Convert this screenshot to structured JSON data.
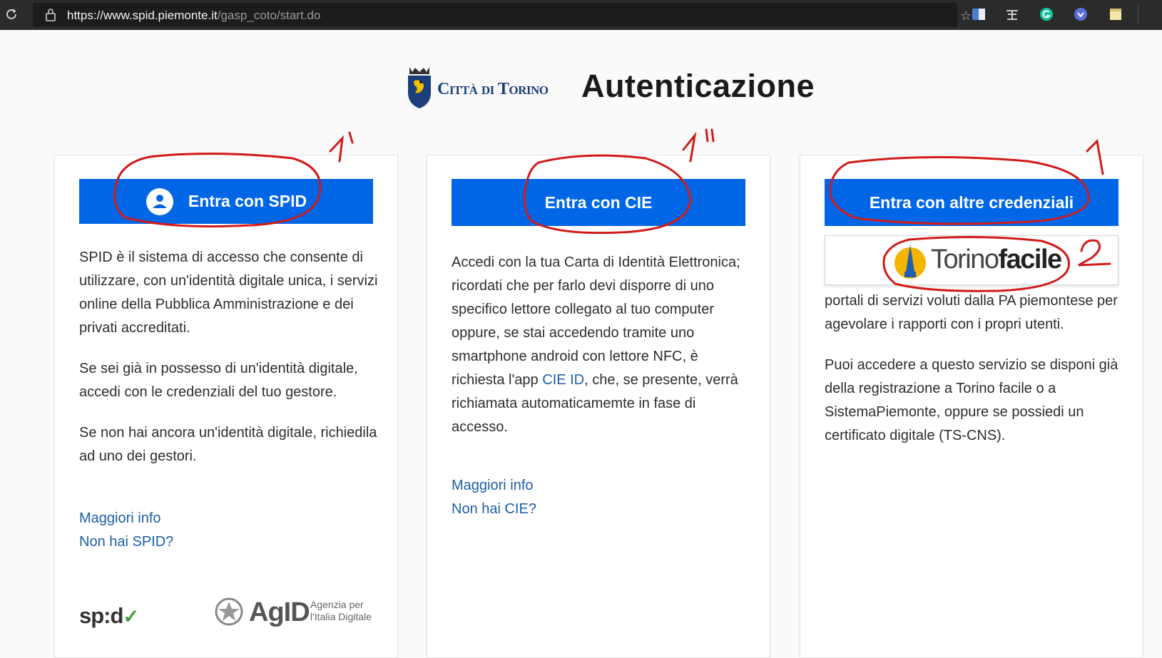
{
  "browser": {
    "url_host": "https://www.spid.piemonte.it",
    "url_path": "/gasp_coto/start.do"
  },
  "header": {
    "city_name": "Città di Torino",
    "title": "Autenticazione"
  },
  "cards": [
    {
      "button_label": "Entra con SPID",
      "paragraphs": [
        "SPID è il sistema di accesso che consente di utilizzare, con un'identità digitale unica, i servizi online della Pubblica Amministrazione e dei privati accreditati.",
        "Se sei già in possesso di un'identità digitale, accedi con le credenziali del tuo gestore.",
        "Se non hai ancora un'identità digitale, richiedila ad uno dei gestori."
      ],
      "link_info": "Maggiori info",
      "link_missing": "Non hai SPID?",
      "logo_spid": "sp:d",
      "logo_agid": "AgID",
      "logo_agid_sub1": "Agenzia per",
      "logo_agid_sub2": "l'Italia Digitale"
    },
    {
      "button_label": "Entra con CIE",
      "text_before_link": "Accedi con la tua Carta di Identità Elettronica; ricordati che per farlo devi disporre di uno specifico lettore collegato al tuo computer oppure, se stai accedendo tramite uno smartphone android con lettore NFC, è richiesta l'app ",
      "inline_link": "CIE ID",
      "text_after_link": ", che, se presente, verrà richiamata automaticamemte in fase di accesso.",
      "link_info": "Maggiori info",
      "link_missing": "Non hai CIE?"
    },
    {
      "button_label": "Entra con altre credenziali",
      "popup_logo_light": "Torino",
      "popup_logo_bold": "facile",
      "paragraphs": [
        "portali di servizi voluti dalla PA piemontese per agevolare i rapporti con i propri utenti.",
        "Puoi accedere a questo servizio se disponi già della registrazione a Torino facile o a SistemaPiemonte, oppure se possiedi un certificato digitale (TS-CNS)."
      ]
    }
  ],
  "annotations": {
    "label_1prime": "1'",
    "label_1double": "1\"",
    "label_1": "1",
    "label_2": "2"
  },
  "colors": {
    "button_blue": "#0066e6",
    "link_blue": "#1d5ea8",
    "annotation_red": "#d11a1a"
  }
}
